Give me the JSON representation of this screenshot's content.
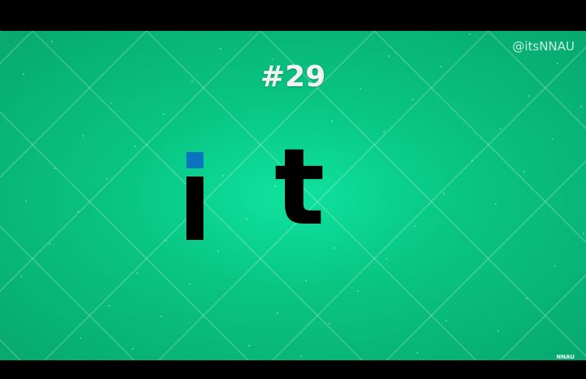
{
  "video": {
    "number": "#29",
    "handle": "@itsNNAU",
    "watermark": "NNAU",
    "word_letters": [
      "i",
      "t"
    ],
    "colors": {
      "background": "#09c584",
      "letters": "#000000",
      "i_dot": "#0a74c0",
      "letterbox": "#000000"
    }
  }
}
